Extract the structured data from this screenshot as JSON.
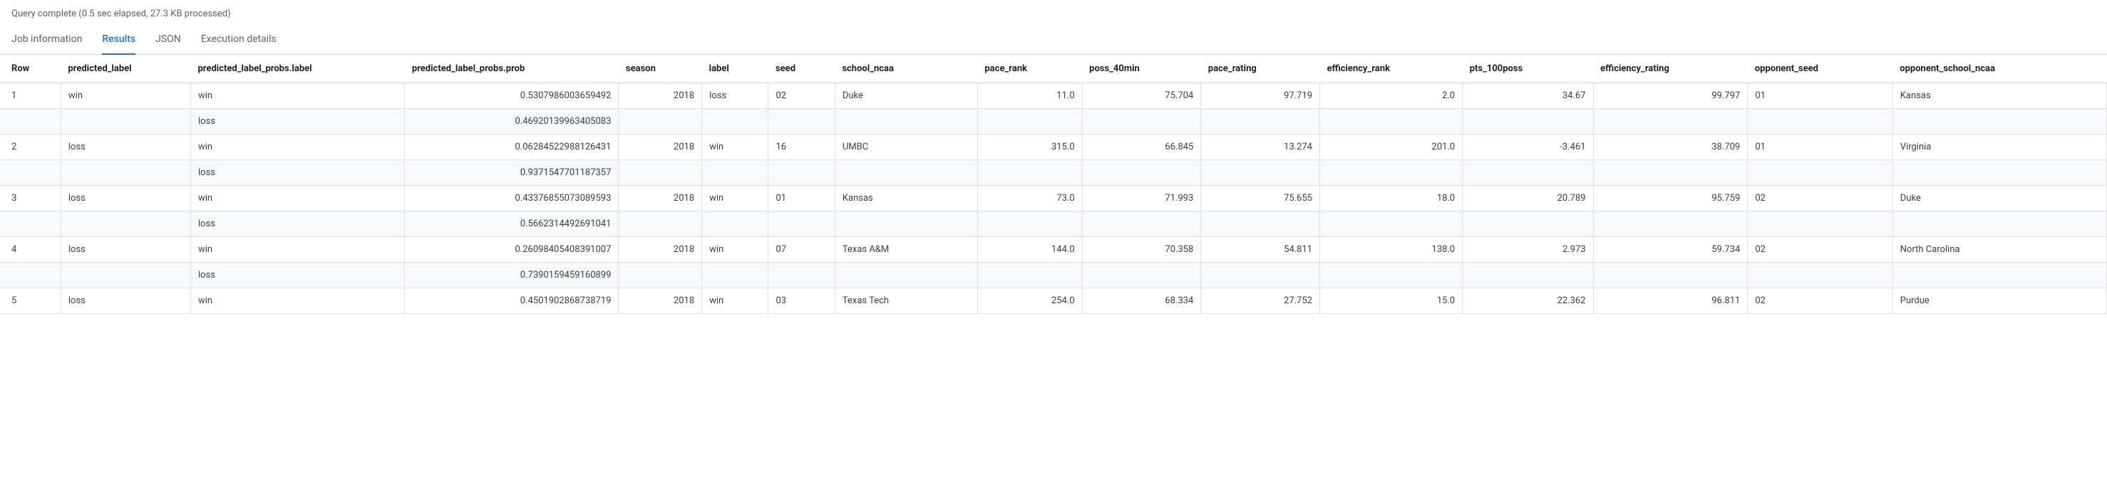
{
  "status": {
    "text": "Query complete (0.5 sec elapsed, 27.3 KB processed)"
  },
  "tabs": {
    "items": [
      {
        "label": "Job information",
        "active": false
      },
      {
        "label": "Results",
        "active": true
      },
      {
        "label": "JSON",
        "active": false
      },
      {
        "label": "Execution details",
        "active": false
      }
    ]
  },
  "columns": [
    "Row",
    "predicted_label",
    "predicted_label_probs.label",
    "predicted_label_probs.prob",
    "season",
    "label",
    "seed",
    "school_ncaa",
    "pace_rank",
    "poss_40min",
    "pace_rating",
    "efficiency_rank",
    "pts_100poss",
    "efficiency_rating",
    "opponent_seed",
    "opponent_school_ncaa"
  ],
  "rows": [
    {
      "row": "1",
      "predicted_label": "win",
      "probs": [
        {
          "label": "win",
          "prob": "0.5307986003659492"
        },
        {
          "label": "loss",
          "prob": "0.46920139963405083"
        }
      ],
      "season": "2018",
      "label": "loss",
      "seed": "02",
      "school_ncaa": "Duke",
      "pace_rank": "11.0",
      "poss_40min": "75.704",
      "pace_rating": "97.719",
      "efficiency_rank": "2.0",
      "pts_100poss": "34.67",
      "efficiency_rating": "99.797",
      "opponent_seed": "01",
      "opponent_school_ncaa": "Kansas"
    },
    {
      "row": "2",
      "predicted_label": "loss",
      "probs": [
        {
          "label": "win",
          "prob": "0.06284522988126431"
        },
        {
          "label": "loss",
          "prob": "0.9371547701187357"
        }
      ],
      "season": "2018",
      "label": "win",
      "seed": "16",
      "school_ncaa": "UMBC",
      "pace_rank": "315.0",
      "poss_40min": "66.845",
      "pace_rating": "13.274",
      "efficiency_rank": "201.0",
      "pts_100poss": "-3.461",
      "efficiency_rating": "38.709",
      "opponent_seed": "01",
      "opponent_school_ncaa": "Virginia"
    },
    {
      "row": "3",
      "predicted_label": "loss",
      "probs": [
        {
          "label": "win",
          "prob": "0.43376855073089593"
        },
        {
          "label": "loss",
          "prob": "0.5662314492691041"
        }
      ],
      "season": "2018",
      "label": "win",
      "seed": "01",
      "school_ncaa": "Kansas",
      "pace_rank": "73.0",
      "poss_40min": "71.993",
      "pace_rating": "75.655",
      "efficiency_rank": "18.0",
      "pts_100poss": "20.789",
      "efficiency_rating": "95.759",
      "opponent_seed": "02",
      "opponent_school_ncaa": "Duke"
    },
    {
      "row": "4",
      "predicted_label": "loss",
      "probs": [
        {
          "label": "win",
          "prob": "0.26098405408391007"
        },
        {
          "label": "loss",
          "prob": "0.7390159459160899"
        }
      ],
      "season": "2018",
      "label": "win",
      "seed": "07",
      "school_ncaa": "Texas A&M",
      "pace_rank": "144.0",
      "poss_40min": "70.358",
      "pace_rating": "54.811",
      "efficiency_rank": "138.0",
      "pts_100poss": "2.973",
      "efficiency_rating": "59.734",
      "opponent_seed": "02",
      "opponent_school_ncaa": "North Carolina"
    },
    {
      "row": "5",
      "predicted_label": "loss",
      "probs": [
        {
          "label": "win",
          "prob": "0.4501902868738719"
        }
      ],
      "season": "2018",
      "label": "win",
      "seed": "03",
      "school_ncaa": "Texas Tech",
      "pace_rank": "254.0",
      "poss_40min": "68.334",
      "pace_rating": "27.752",
      "efficiency_rank": "15.0",
      "pts_100poss": "22.362",
      "efficiency_rating": "96.811",
      "opponent_seed": "02",
      "opponent_school_ncaa": "Purdue"
    }
  ]
}
